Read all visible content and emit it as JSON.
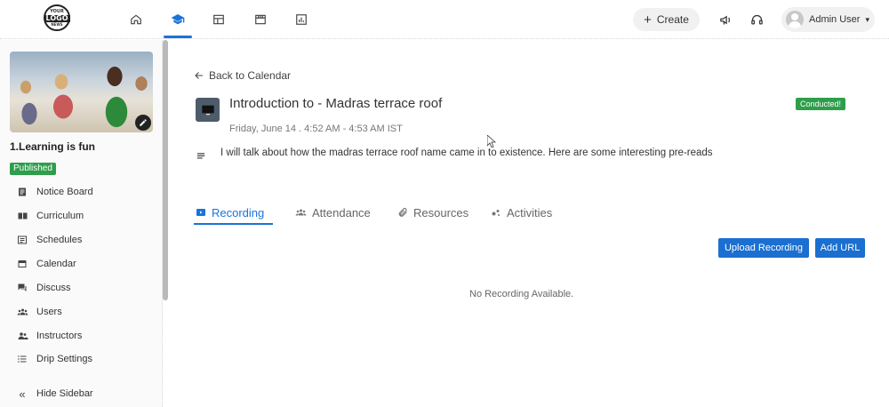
{
  "header": {
    "logo": {
      "line1": "YOUR",
      "line2": "LOGO",
      "line3": "NEWS"
    },
    "nav_icons": [
      "home-icon",
      "graduation-cap-icon",
      "dashboard-icon",
      "store-icon",
      "analytics-icon"
    ],
    "create_label": "Create",
    "user_name": "Admin User",
    "accent_color": "#1a73d9"
  },
  "sidebar": {
    "course_title": "1.Learning is fun",
    "status_badge": "Published",
    "items": [
      {
        "label": "Notice Board",
        "icon": "notice-board-icon"
      },
      {
        "label": "Curriculum",
        "icon": "curriculum-icon"
      },
      {
        "label": "Schedules",
        "icon": "schedules-icon"
      },
      {
        "label": "Calendar",
        "icon": "calendar-icon"
      },
      {
        "label": "Discuss",
        "icon": "discuss-icon"
      },
      {
        "label": "Users",
        "icon": "users-icon"
      },
      {
        "label": "Instructors",
        "icon": "instructors-icon"
      },
      {
        "label": "Drip Settings",
        "icon": "drip-settings-icon"
      }
    ],
    "hide_label": "Hide Sidebar"
  },
  "main": {
    "back_label": "Back to Calendar",
    "session_title": "Introduction to - Madras terrace roof",
    "session_status": "Conducted!",
    "session_time": "Friday, June 14 . 4:52 AM - 4:53 AM IST",
    "description": "I will talk about how the madras terrace roof name came in to existence. Here are some interesting pre-reads",
    "tabs": [
      {
        "label": "Recording",
        "icon": "play-icon"
      },
      {
        "label": "Attendance",
        "icon": "people-icon"
      },
      {
        "label": "Resources",
        "icon": "paperclip-icon"
      },
      {
        "label": "Activities",
        "icon": "activities-icon"
      }
    ],
    "upload_label": "Upload Recording",
    "add_url_label": "Add URL",
    "empty_message": "No Recording Available.",
    "status_color": "#2e9e4b"
  }
}
